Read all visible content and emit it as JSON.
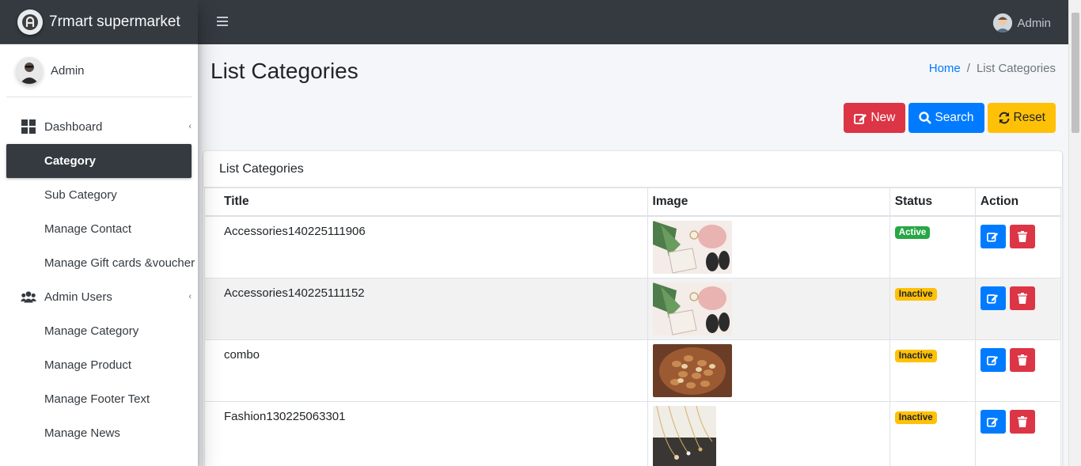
{
  "brand": {
    "name": "7rmart supermarket"
  },
  "sidebar": {
    "user_name": "Admin",
    "items": [
      {
        "label": "Dashboard",
        "icon": "dashboard-icon",
        "has_caret": true
      },
      {
        "label": "Category",
        "active": true
      },
      {
        "label": "Sub Category"
      },
      {
        "label": "Manage Contact"
      },
      {
        "label": "Manage Gift cards &voucher"
      },
      {
        "label": "Admin Users",
        "icon": "users-icon",
        "has_caret": true
      },
      {
        "label": "Manage Category"
      },
      {
        "label": "Manage Product"
      },
      {
        "label": "Manage Footer Text"
      },
      {
        "label": "Manage News"
      }
    ]
  },
  "navbar": {
    "user_label": "Admin"
  },
  "page": {
    "title": "List Categories",
    "breadcrumb": {
      "home": "Home",
      "separator": "/",
      "current": "List Categories"
    },
    "buttons": {
      "new": "New",
      "search": "Search",
      "reset": "Reset"
    }
  },
  "card": {
    "header": "List Categories",
    "columns": {
      "title": "Title",
      "image": "Image",
      "status": "Status",
      "action": "Action"
    },
    "rows": [
      {
        "title": "Accessories140225111906",
        "status": "Active",
        "image": "accessories-photo"
      },
      {
        "title": "Accessories140225111152",
        "status": "Inactive",
        "image": "accessories-photo"
      },
      {
        "title": "combo",
        "status": "Inactive",
        "image": "nuts-photo"
      },
      {
        "title": "Fashion130225063301",
        "status": "Inactive",
        "image": "necklaces-photo"
      }
    ]
  },
  "colors": {
    "navbar_bg": "#343a40",
    "primary": "#007bff",
    "danger": "#dc3545",
    "warning": "#ffc107",
    "success": "#28a745"
  }
}
